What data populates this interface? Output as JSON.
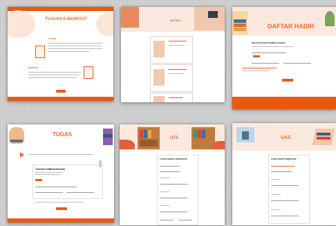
{
  "panels": {
    "tujuan": {
      "title": "TUJUAN & MANFAAT",
      "tujuan_label": "TUJUAN",
      "manfaat_label": "MANFAAT"
    },
    "materi": {
      "title": "MATERI"
    },
    "daftar": {
      "title": "DAFTAR HADIR",
      "form_title": "DAFTAR HADIR PEMBELAJARAN"
    },
    "tugas": {
      "title": "TUGAS",
      "form_title": "TUGAS KEBUDAYAAN"
    },
    "uts": {
      "title": "UTS",
      "form_title": "UJIAN TENGAH SEMESTER"
    },
    "uas": {
      "title": "UAS",
      "form_title": "UJIAN AKHIR SEMESTER"
    }
  },
  "colors": {
    "accent": "#e65a12",
    "title": "#ee6a2a",
    "background": "#cfcfcf"
  }
}
